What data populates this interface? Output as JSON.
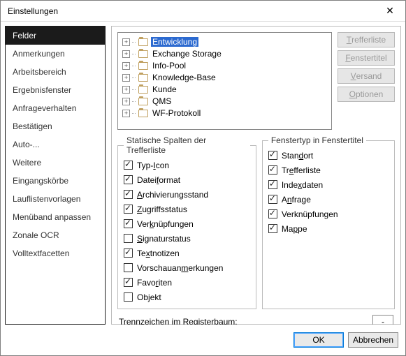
{
  "window": {
    "title": "Einstellungen"
  },
  "nav": {
    "items": [
      {
        "label": "Felder",
        "selected": true
      },
      {
        "label": "Anmerkungen"
      },
      {
        "label": "Arbeitsbereich"
      },
      {
        "label": "Ergebnisfenster"
      },
      {
        "label": "Anfrageverhalten"
      },
      {
        "label": "Bestätigen"
      },
      {
        "label": "Auto-..."
      },
      {
        "label": "Weitere"
      },
      {
        "label": "Eingangskörbe"
      },
      {
        "label": "Lauflistenvorlagen"
      },
      {
        "label": "Menüband anpassen"
      },
      {
        "label": "Zonale OCR"
      },
      {
        "label": "Volltextfacetten"
      }
    ]
  },
  "tree": {
    "items": [
      {
        "label": "Entwicklung",
        "selected": true
      },
      {
        "label": "Exchange Storage"
      },
      {
        "label": "Info-Pool"
      },
      {
        "label": "Knowledge-Base"
      },
      {
        "label": "Kunde"
      },
      {
        "label": "QMS"
      },
      {
        "label": "WF-Protokoll"
      }
    ]
  },
  "buttons": {
    "b0": {
      "pre": "",
      "u": "T",
      "post": "refferliste"
    },
    "b1": {
      "pre": "",
      "u": "F",
      "post": "enstertitel"
    },
    "b2": {
      "pre": "",
      "u": "V",
      "post": "ersand"
    },
    "b3": {
      "pre": "",
      "u": "O",
      "post": "ptionen"
    }
  },
  "group1": {
    "legend": "Statische Spalten der Trefferliste",
    "items": [
      {
        "pre": "Typ-",
        "u": "I",
        "post": "con",
        "checked": true
      },
      {
        "pre": "Datei",
        "u": "f",
        "post": "ormat",
        "checked": true
      },
      {
        "pre": "",
        "u": "A",
        "post": "rchivierungsstand",
        "checked": true
      },
      {
        "pre": "",
        "u": "Z",
        "post": "ugriffsstatus",
        "checked": true
      },
      {
        "pre": "Ver",
        "u": "k",
        "post": "nüpfungen",
        "checked": true
      },
      {
        "pre": "",
        "u": "S",
        "post": "ignaturstatus",
        "checked": false
      },
      {
        "pre": "Te",
        "u": "x",
        "post": "tnotizen",
        "checked": true
      },
      {
        "pre": "Vorschauan",
        "u": "m",
        "post": "erkungen",
        "checked": false
      },
      {
        "pre": "Favo",
        "u": "r",
        "post": "iten",
        "checked": true
      },
      {
        "pre": "Ob",
        "u": "j",
        "post": "ekt",
        "checked": false
      }
    ]
  },
  "group2": {
    "legend": "Fenstertyp in Fenstertitel",
    "items": [
      {
        "pre": "Stan",
        "u": "d",
        "post": "ort",
        "checked": true
      },
      {
        "pre": "Tr",
        "u": "e",
        "post": "fferliste",
        "checked": true
      },
      {
        "pre": "Inde",
        "u": "x",
        "post": "daten",
        "checked": true
      },
      {
        "pre": "A",
        "u": "n",
        "post": "frage",
        "checked": true
      },
      {
        "pre": "Verknüpfun",
        "u": "g",
        "post": "en",
        "checked": true
      },
      {
        "pre": "Ma",
        "u": "p",
        "post": "pe",
        "checked": true
      }
    ]
  },
  "separator": {
    "label": "Trennzeichen im Registerbaum:",
    "value": "-"
  },
  "footer": {
    "ok": "OK",
    "cancel": "Abbrechen"
  }
}
